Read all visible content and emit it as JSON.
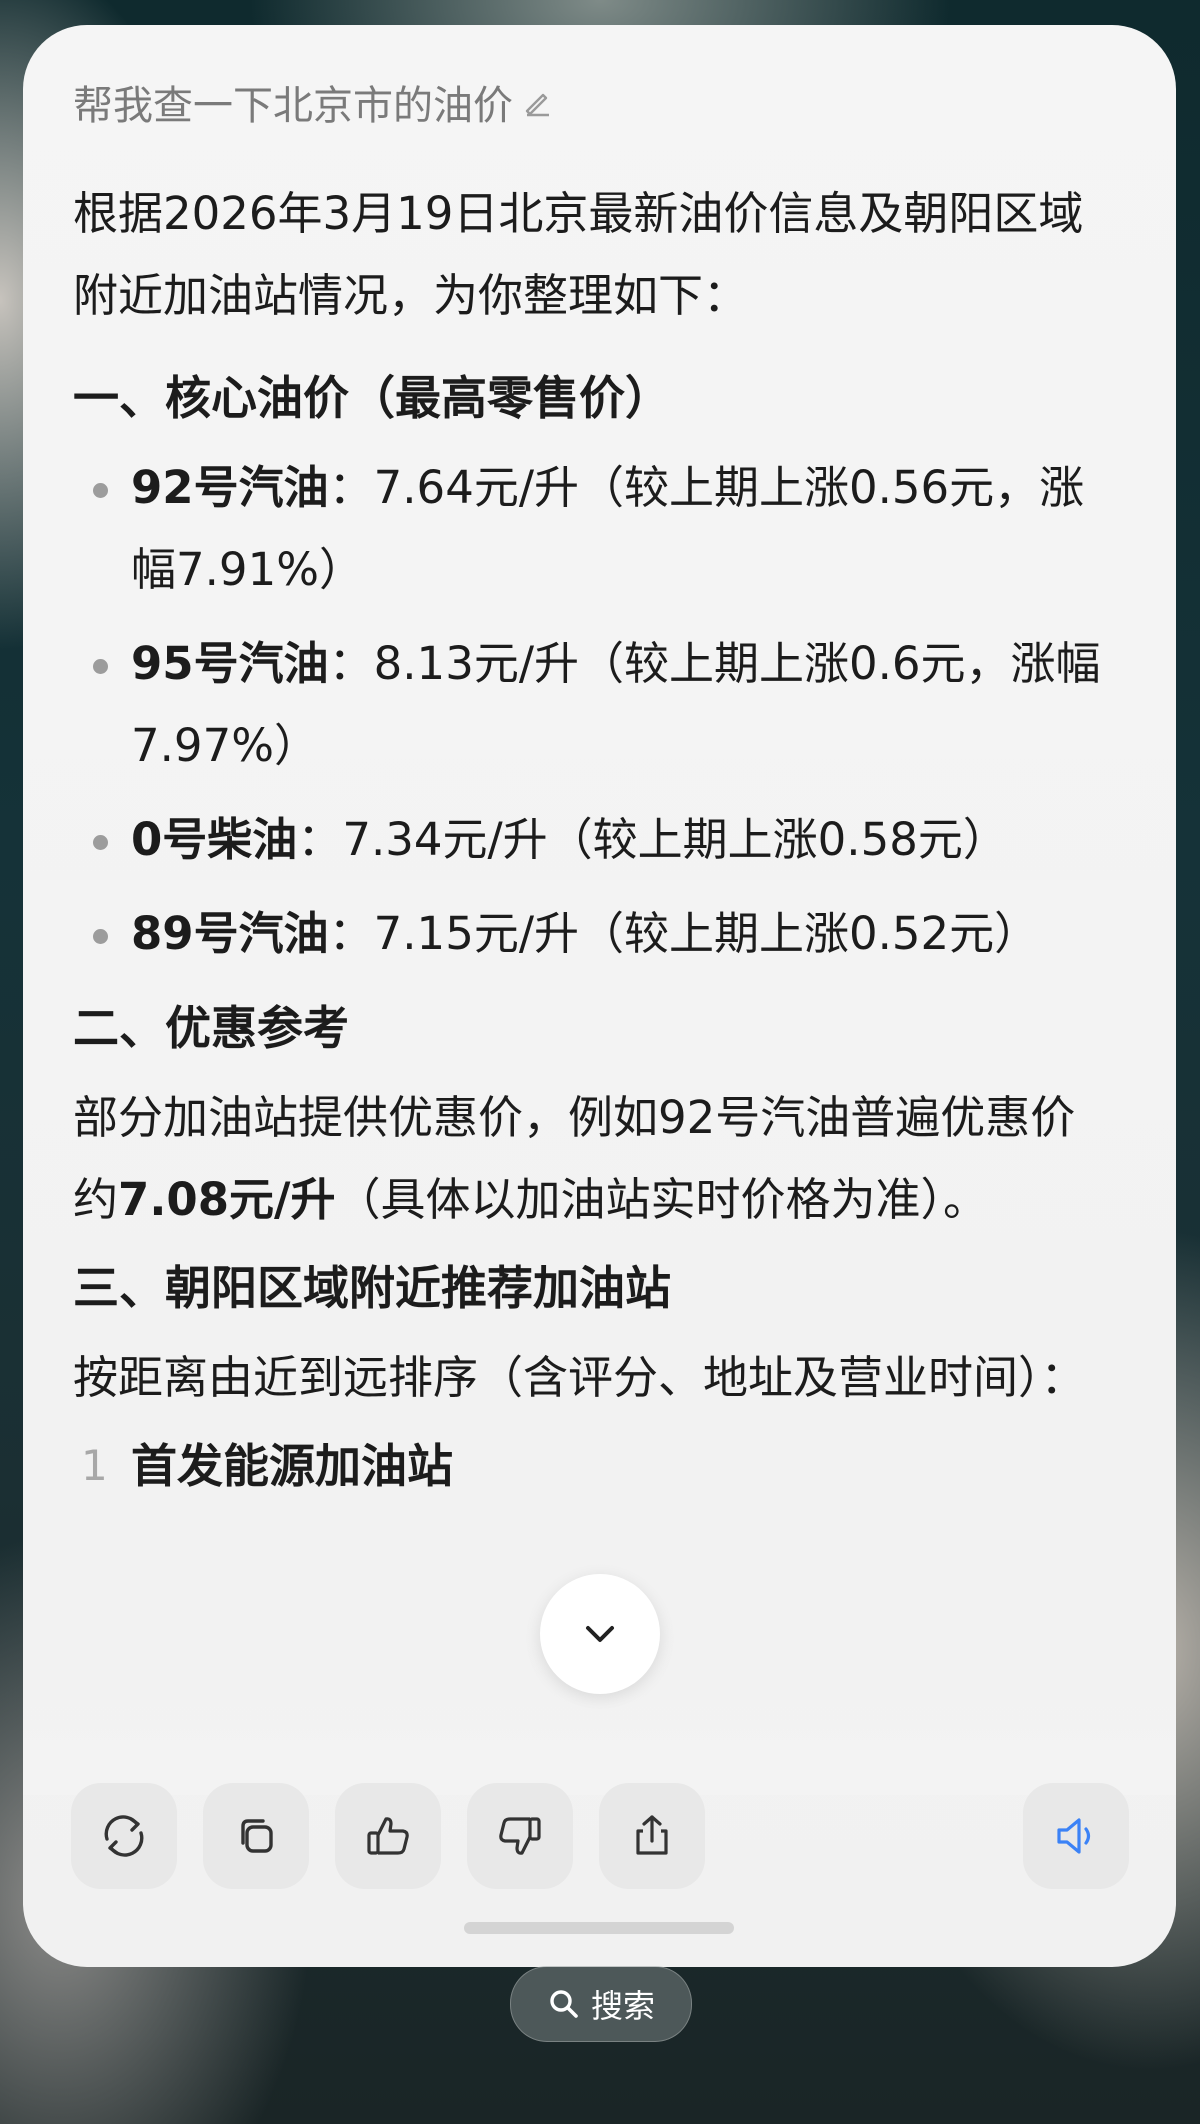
{
  "query": {
    "text": "帮我查一下北京市的油价"
  },
  "intro": "根据2026年3月19日北京最新油价信息及朝阳区域附近加油站情况，为你整理如下：",
  "section1": {
    "title": "一、核心油价（最高零售价）",
    "items": [
      {
        "label": "92号汽油",
        "text": "：7.64元/升（较上期上涨0.56元，涨幅7.91%）"
      },
      {
        "label": "95号汽油",
        "text": "：8.13元/升（较上期上涨0.6元，涨幅7.97%）"
      },
      {
        "label": "0号柴油",
        "text": "：7.34元/升（较上期上涨0.58元）"
      },
      {
        "label": "89号汽油",
        "text": "：7.15元/升（较上期上涨0.52元）"
      }
    ]
  },
  "section2": {
    "title": "二、优惠参考",
    "text_before": "部分加油站提供优惠价，例如92号汽油普遍优惠价约",
    "highlight": "7.08元/升",
    "text_after": "（具体以加油站实时价格为准）。"
  },
  "section3": {
    "title": "三、朝阳区域附近推荐加油站",
    "desc": "按距离由近到远排序（含评分、地址及营业时间）：",
    "stations": [
      {
        "num": "1",
        "name": "首发能源加油站"
      }
    ]
  },
  "actions": {
    "icons": [
      "refresh-icon",
      "copy-icon",
      "thumbs-up-icon",
      "thumbs-down-icon",
      "share-icon",
      "speaker-icon"
    ],
    "accent": "#3b82f6"
  },
  "search": {
    "label": "搜索"
  }
}
